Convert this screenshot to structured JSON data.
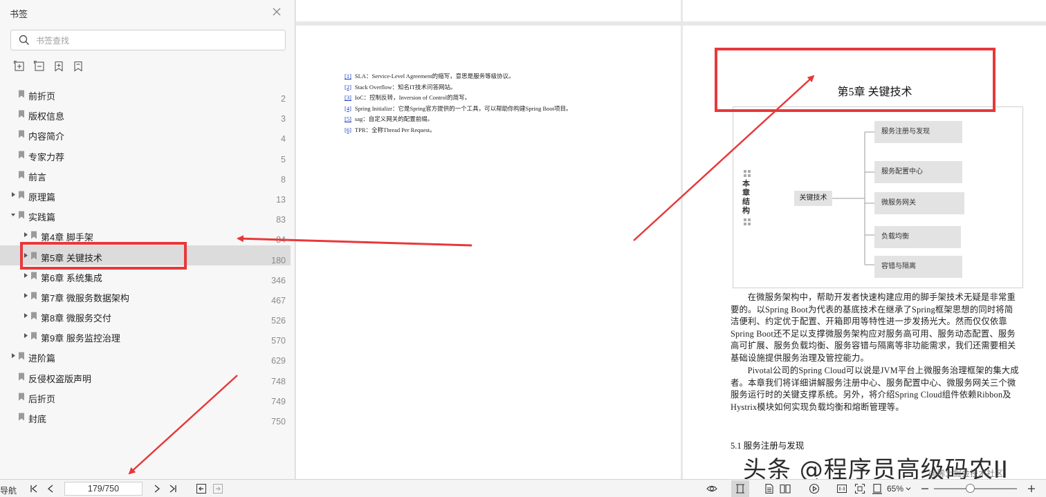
{
  "sidebar": {
    "title": "书签",
    "search_placeholder": "书签查找",
    "tool_icons": [
      "expand-all-icon",
      "collapse-all-icon",
      "add-bookmark-icon",
      "bookmark-icon"
    ],
    "items": [
      {
        "label": "前折页",
        "page": "2",
        "level": 0,
        "expandable": false
      },
      {
        "label": "版权信息",
        "page": "3",
        "level": 0,
        "expandable": false
      },
      {
        "label": "内容简介",
        "page": "4",
        "level": 0,
        "expandable": false
      },
      {
        "label": "专家力荐",
        "page": "5",
        "level": 0,
        "expandable": false
      },
      {
        "label": "前言",
        "page": "8",
        "level": 0,
        "expandable": false
      },
      {
        "label": "原理篇",
        "page": "13",
        "level": 0,
        "expandable": true,
        "expanded": false
      },
      {
        "label": "实践篇",
        "page": "83",
        "level": 0,
        "expandable": true,
        "expanded": true
      },
      {
        "label": "第4章 脚手架",
        "page": "84",
        "level": 1,
        "expandable": true,
        "expanded": false
      },
      {
        "label": "第5章 关键技术",
        "page": "180",
        "level": 1,
        "expandable": true,
        "expanded": false,
        "selected": true
      },
      {
        "label": "第6章 系统集成",
        "page": "346",
        "level": 1,
        "expandable": true,
        "expanded": false
      },
      {
        "label": "第7章 微服务数据架构",
        "page": "467",
        "level": 1,
        "expandable": true,
        "expanded": false
      },
      {
        "label": "第8章 微服务交付",
        "page": "526",
        "level": 1,
        "expandable": true,
        "expanded": false
      },
      {
        "label": "第9章 服务监控治理",
        "page": "570",
        "level": 1,
        "expandable": true,
        "expanded": false
      },
      {
        "label": "进阶篇",
        "page": "629",
        "level": 0,
        "expandable": true,
        "expanded": false
      },
      {
        "label": "反侵权盗版声明",
        "page": "748",
        "level": 0,
        "expandable": false
      },
      {
        "label": "后折页",
        "page": "749",
        "level": 0,
        "expandable": false
      },
      {
        "label": "封底",
        "page": "750",
        "level": 0,
        "expandable": false
      }
    ]
  },
  "left_page": {
    "footnotes": [
      {
        "num": "[1]",
        "text": "SLA：Service-Level Agreement的缩写，意思是服务等级协议。"
      },
      {
        "num": "[2]",
        "text": "Stack Overflow：知名IT技术问答网站。"
      },
      {
        "num": "[3]",
        "text": "IoC：控制反转，Inversion of Control的简写。"
      },
      {
        "num": "[4]",
        "text": "Spring Initializr：它是Spring官方提供的一个工具，可以帮助你构建Spring Boot项目。"
      },
      {
        "num": "[5]",
        "text": "sag：自定义网关的配置前缀。"
      },
      {
        "num": "[6]",
        "text": "TPR：全称Thread Per Request。"
      }
    ]
  },
  "right_page": {
    "chapter_title": "第5章  关键技术",
    "diagram": {
      "side_label": "本章结构",
      "root": "关键技术",
      "leaves": [
        "服务注册与发现",
        "服务配置中心",
        "微服务网关",
        "负载均衡",
        "容错与隔离"
      ]
    },
    "paragraphs": [
      "在微服务架构中，帮助开发者快速构建应用的脚手架技术无疑是非常重要的。以Spring Boot为代表的基底技术在继承了Spring框架思想的同时将简洁便利、约定优于配置、开箱即用等特性进一步发扬光大。然而仅仅依靠Spring Boot还不足以支撑微服务架构应对服务高可用、服务动态配置、服务高可扩展、服务负载均衡、服务容错与隔离等非功能需求，我们还需要相关基础设施提供服务治理及管控能力。",
      "Pivotal公司的Spring Cloud可以说是JVM平台上微服务治理框架的集大成者。本章我们将详细讲解服务注册中心、服务配置中心、微服务网关三个微服务运行时的关键支撑系统。另外，将介绍Spring Cloud组件依赖Ribbon及Hystrix模块如何实现负载均衡和熔断管理等。"
    ],
    "section_title": "5.1  服务注册与发现"
  },
  "watermark": {
    "main": "头条 @程序员高级码农II",
    "sub": "@稀土掘金技术社区"
  },
  "statusbar": {
    "nav_label": "导航",
    "page_value": "179/750",
    "zoom": "65%",
    "zoom_fraction": 0.43,
    "icons": [
      "first-page-icon",
      "prev-page-icon",
      "next-page-icon",
      "last-page-icon",
      "back-icon",
      "forward-icon",
      "eye-icon",
      "single-page-icon",
      "continuous-icon",
      "two-page-icon",
      "play-icon",
      "actual-size-icon",
      "fit-page-icon",
      "fit-width-icon",
      "zoom-out-icon",
      "zoom-in-icon"
    ]
  },
  "annotation_color": "#e8383a"
}
